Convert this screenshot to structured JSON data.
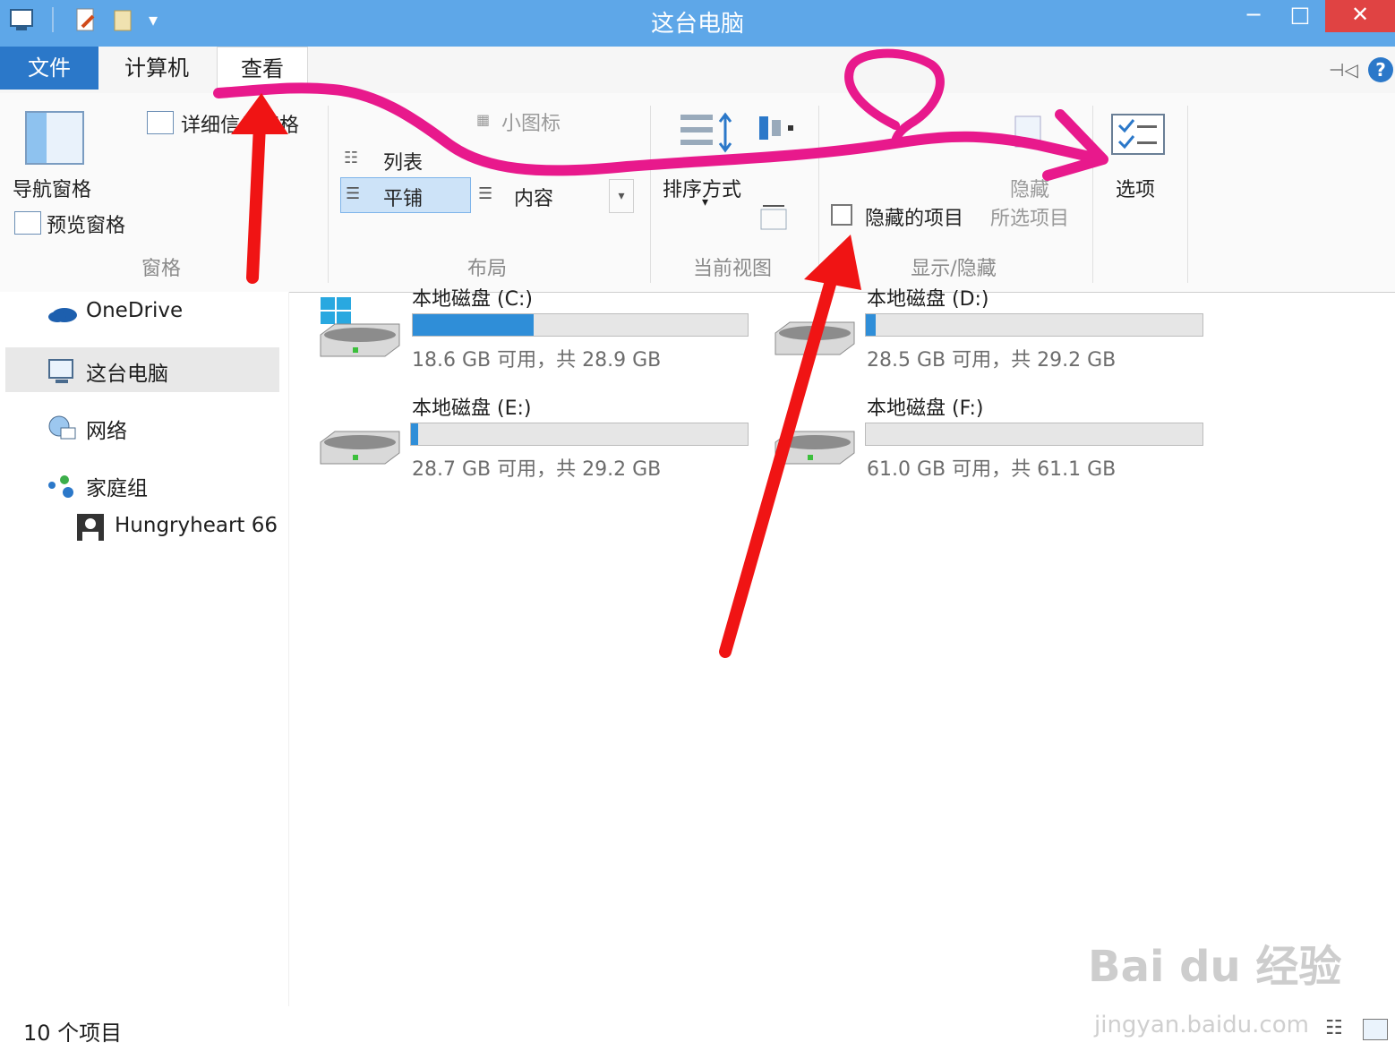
{
  "window": {
    "title": "这台电脑",
    "minimize": "−",
    "maximize": "□",
    "close": "✕"
  },
  "ribbon": {
    "tabs": [
      "文件",
      "计算机",
      "查看"
    ],
    "panes": {
      "navigation_pane": "导航窗格",
      "preview_pane": "预览窗格",
      "details_pane": "详细信息窗格",
      "group_label": "窗格"
    },
    "layout": {
      "small_icons": "小图标",
      "list": "列表",
      "tiles": "平铺",
      "content": "内容",
      "group_label": "布局"
    },
    "current_view": {
      "sort_by": "排序方式",
      "group_label": "当前视图"
    },
    "show_hide": {
      "hidden_items": "隐藏的项目",
      "hide": "隐藏",
      "selected_items": "所选项目",
      "group_label": "显示/隐藏"
    },
    "options": "选项"
  },
  "nav": {
    "onedrive": "OneDrive",
    "this_pc": "这台电脑",
    "network": "网络",
    "homegroup": "家庭组",
    "user": "Hungryheart 66"
  },
  "drives": [
    {
      "name": "本地磁盘 (C:)",
      "info": "18.6 GB 可用，共 28.9 GB",
      "used_fraction": 0.36
    },
    {
      "name": "本地磁盘 (D:)",
      "info": "28.5 GB 可用，共 29.2 GB",
      "used_fraction": 0.03
    },
    {
      "name": "本地磁盘 (E:)",
      "info": "28.7 GB 可用，共 29.2 GB",
      "used_fraction": 0.02
    },
    {
      "name": "本地磁盘 (F:)",
      "info": "61.0 GB 可用，共 61.1 GB",
      "used_fraction": 0.0
    }
  ],
  "status": {
    "item_count": "10 个项目"
  },
  "watermark": {
    "brand": "Bai du 经验",
    "url": "jingyan.baidu.com"
  },
  "colors": {
    "titlebar": "#5ea7e8",
    "file_tab": "#2b78c9",
    "close_button": "#e04343",
    "annotation_red": "#f01414",
    "annotation_magenta": "#e8198c"
  }
}
